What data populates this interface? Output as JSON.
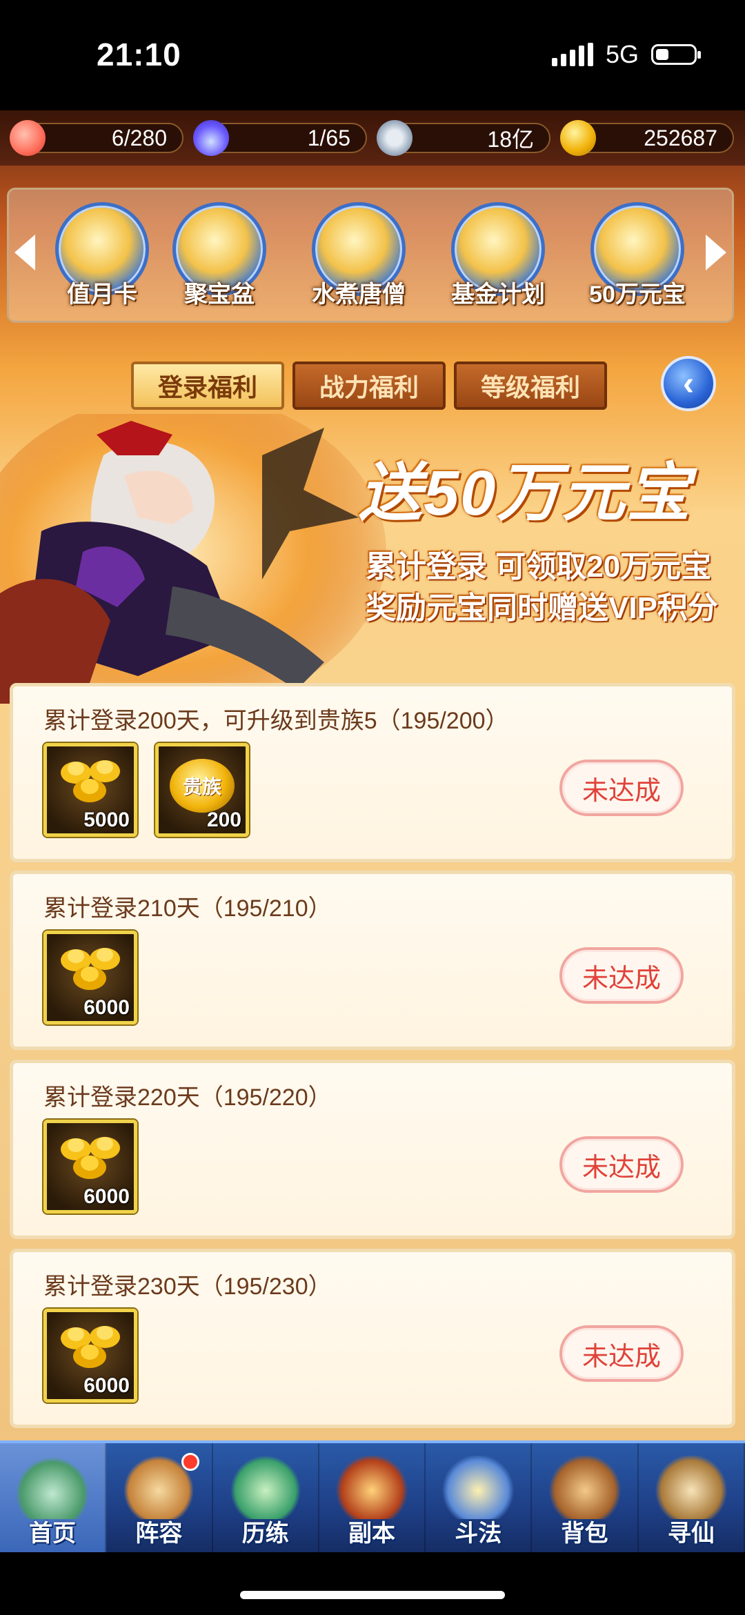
{
  "status_bar": {
    "time": "21:10",
    "network": "5G"
  },
  "resources": [
    {
      "icon": "peach-icon",
      "value": "6/280"
    },
    {
      "icon": "spirit-flame-icon",
      "value": "1/65"
    },
    {
      "icon": "copper-coin-icon",
      "value": "18亿"
    },
    {
      "icon": "gold-ingot-icon",
      "value": "252687"
    }
  ],
  "events": [
    {
      "label": "值月卡"
    },
    {
      "label": "聚宝盆"
    },
    {
      "label": "水煮唐僧"
    },
    {
      "label": "基金计划"
    },
    {
      "label": "50万元宝"
    }
  ],
  "tabs": [
    {
      "label": "登录福利",
      "active": true
    },
    {
      "label": "战力福利",
      "active": false
    },
    {
      "label": "等级福利",
      "active": false
    }
  ],
  "banner": {
    "title": "送50万元宝",
    "line1": "累计登录 可领取20万元宝",
    "line2": "奖励元宝同时赠送VIP积分"
  },
  "rewards": [
    {
      "title": "累计登录200天，可升级到贵族5（195/200）",
      "items": [
        {
          "icon": "gold-ingot-pile-icon",
          "qty": "5000"
        },
        {
          "icon": "noble-badge-icon",
          "badge": "贵族",
          "qty": "200"
        }
      ],
      "status": "未达成"
    },
    {
      "title": "累计登录210天（195/210）",
      "items": [
        {
          "icon": "gold-ingot-pile-icon",
          "qty": "6000"
        }
      ],
      "status": "未达成"
    },
    {
      "title": "累计登录220天（195/220）",
      "items": [
        {
          "icon": "gold-ingot-pile-icon",
          "qty": "6000"
        }
      ],
      "status": "未达成"
    },
    {
      "title": "累计登录230天（195/230）",
      "items": [
        {
          "icon": "gold-ingot-pile-icon",
          "qty": "6000"
        }
      ],
      "status": "未达成"
    }
  ],
  "nav": [
    {
      "label": "首页",
      "icon": "home-icon"
    },
    {
      "label": "阵容",
      "icon": "lineup-icon",
      "badge": true
    },
    {
      "label": "历练",
      "icon": "training-icon"
    },
    {
      "label": "副本",
      "icon": "dungeon-gate-icon"
    },
    {
      "label": "斗法",
      "icon": "duel-icon"
    },
    {
      "label": "背包",
      "icon": "backpack-icon"
    },
    {
      "label": "寻仙",
      "icon": "quest-scroll-icon"
    }
  ]
}
